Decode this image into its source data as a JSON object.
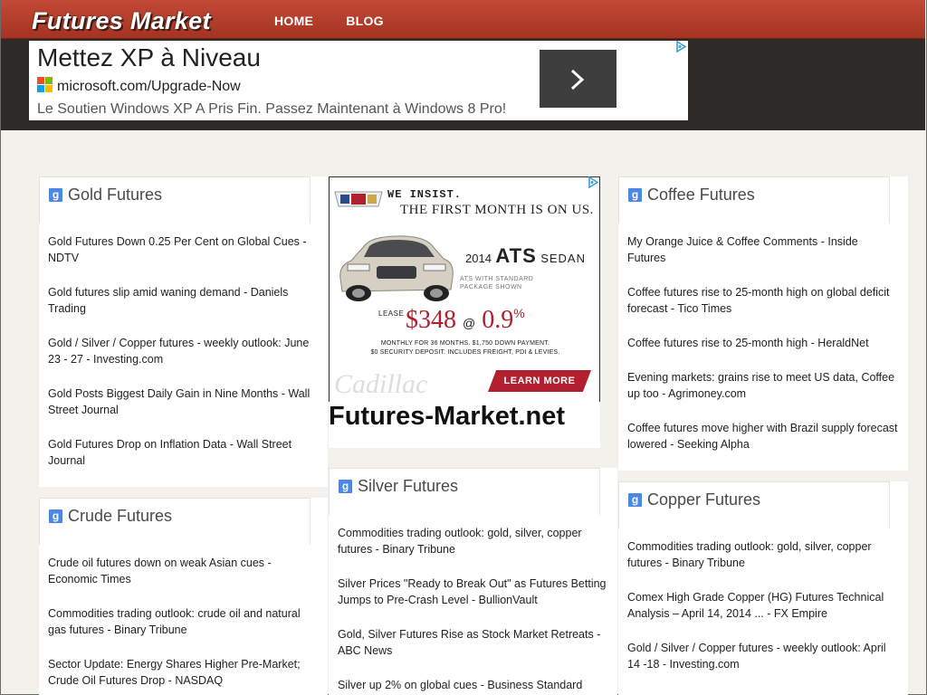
{
  "header": {
    "logo": "Futures Market",
    "nav": [
      "HOME",
      "BLOG"
    ]
  },
  "top_ad": {
    "headline": "Mettez XP à Niveau",
    "url": "microsoft.com/Upgrade-Now",
    "description": "Le Soutien Windows XP A Pris Fin. Passez Maintenant à Windows 8 Pro!",
    "icons": [
      "microsoft-logo-icon",
      "chevron-right-icon",
      "adchoices-icon"
    ]
  },
  "middle_ad": {
    "line1": "WE INSIST.",
    "line2": "THE FIRST MONTH IS ON US.",
    "year": "2014",
    "model": "ATS",
    "body": "SEDAN",
    "standard": "ATS WITH STANDARD\nPACKAGE SHOWN",
    "lease_label": "LEASE",
    "price": "$348",
    "at": "@",
    "rate": "0.9",
    "percent": "%",
    "terms_1": "MONTHLY FOR 36 MONTHS. $1,750 DOWN PAYMENT.",
    "terms_2": "$0 SECURITY DEPOSIT. INCLUDES FREIGHT, PDI & LEVIES.",
    "learn_more": "LEARN MORE",
    "brand": "Cadillac"
  },
  "site_name": "Futures-Market.net",
  "columns": {
    "gold": {
      "title": "Gold Futures",
      "items": [
        "Gold Futures Down 0.25 Per Cent on Global Cues - NDTV",
        "Gold futures slip amid waning demand - Daniels Trading",
        "Gold / Silver / Copper futures - weekly outlook: June 23 - 27 - Investing.com",
        "Gold Posts Biggest Daily Gain in Nine Months - Wall Street Journal",
        "Gold Futures Drop on Inflation Data - Wall Street Journal"
      ]
    },
    "crude": {
      "title": "Crude Futures",
      "items": [
        "Crude oil futures down on weak Asian cues - Economic Times",
        "Commodities trading outlook: crude oil and natural gas futures - Binary Tribune",
        "Sector Update: Energy Shares Higher Pre-Market; Crude Oil Futures Drop - NASDAQ"
      ]
    },
    "silver": {
      "title": "Silver Futures",
      "items": [
        "Commodities trading outlook: gold, silver, copper futures - Binary Tribune",
        "Silver Prices \"Ready to Break Out\" as Futures Betting Jumps to Pre-Crash Level - BullionVault",
        "Gold, Silver Futures Rise as Stock Market Retreats - ABC News",
        "Silver up 2% on global cues - Business Standard"
      ]
    },
    "coffee": {
      "title": "Coffee Futures",
      "items": [
        "My Orange Juice & Coffee Comments - Inside Futures",
        "Coffee futures rise to 25-month high on global deficit forecast - Tico Times",
        "Coffee futures rise to 25-month high - HeraldNet",
        "Evening markets: grains rise to meet US data, Coffee up too - Agrimoney.com",
        "Coffee futures move higher with Brazil supply forecast lowered - Seeking Alpha"
      ]
    },
    "copper": {
      "title": "Copper Futures",
      "items": [
        "Commodities trading outlook: gold, silver, copper futures - Binary Tribune",
        "Comex High Grade Copper (HG) Futures Technical Analysis – April 14, 2014 ... - FX Empire",
        "Gold / Silver / Copper futures - weekly outlook: April 14 -18 - Investing.com"
      ]
    }
  },
  "colors": {
    "header": "#b03c2a",
    "band": "#2e2a27",
    "background": "#f2f1ec",
    "google_icon": "#4d87e6",
    "cadillac_red": "#b2202f"
  }
}
